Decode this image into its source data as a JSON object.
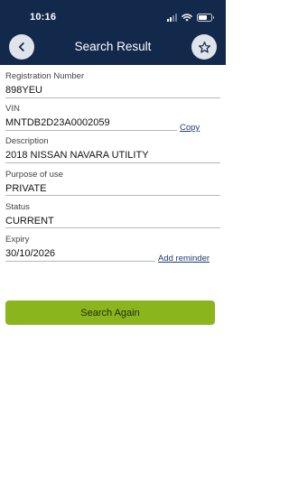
{
  "status_bar": {
    "time": "10:16"
  },
  "header": {
    "title": "Search Result",
    "back_icon": "chevron-left-icon",
    "favorite_icon": "star-outline-icon",
    "background_color": "#13294b"
  },
  "fields": {
    "registration": {
      "label": "Registration Number",
      "value": "898YEU"
    },
    "vin": {
      "label": "VIN",
      "value": "MNTDB2D23A0002059",
      "action": "Copy"
    },
    "description": {
      "label": "Description",
      "value": "2018 NISSAN NAVARA UTILITY"
    },
    "purpose": {
      "label": "Purpose of use",
      "value": "PRIVATE"
    },
    "status": {
      "label": "Status",
      "value": "CURRENT"
    },
    "expiry": {
      "label": "Expiry",
      "value": "30/10/2026",
      "action": "Add reminder"
    }
  },
  "search_again": {
    "label": "Search Again",
    "color": "#8ab51d"
  }
}
